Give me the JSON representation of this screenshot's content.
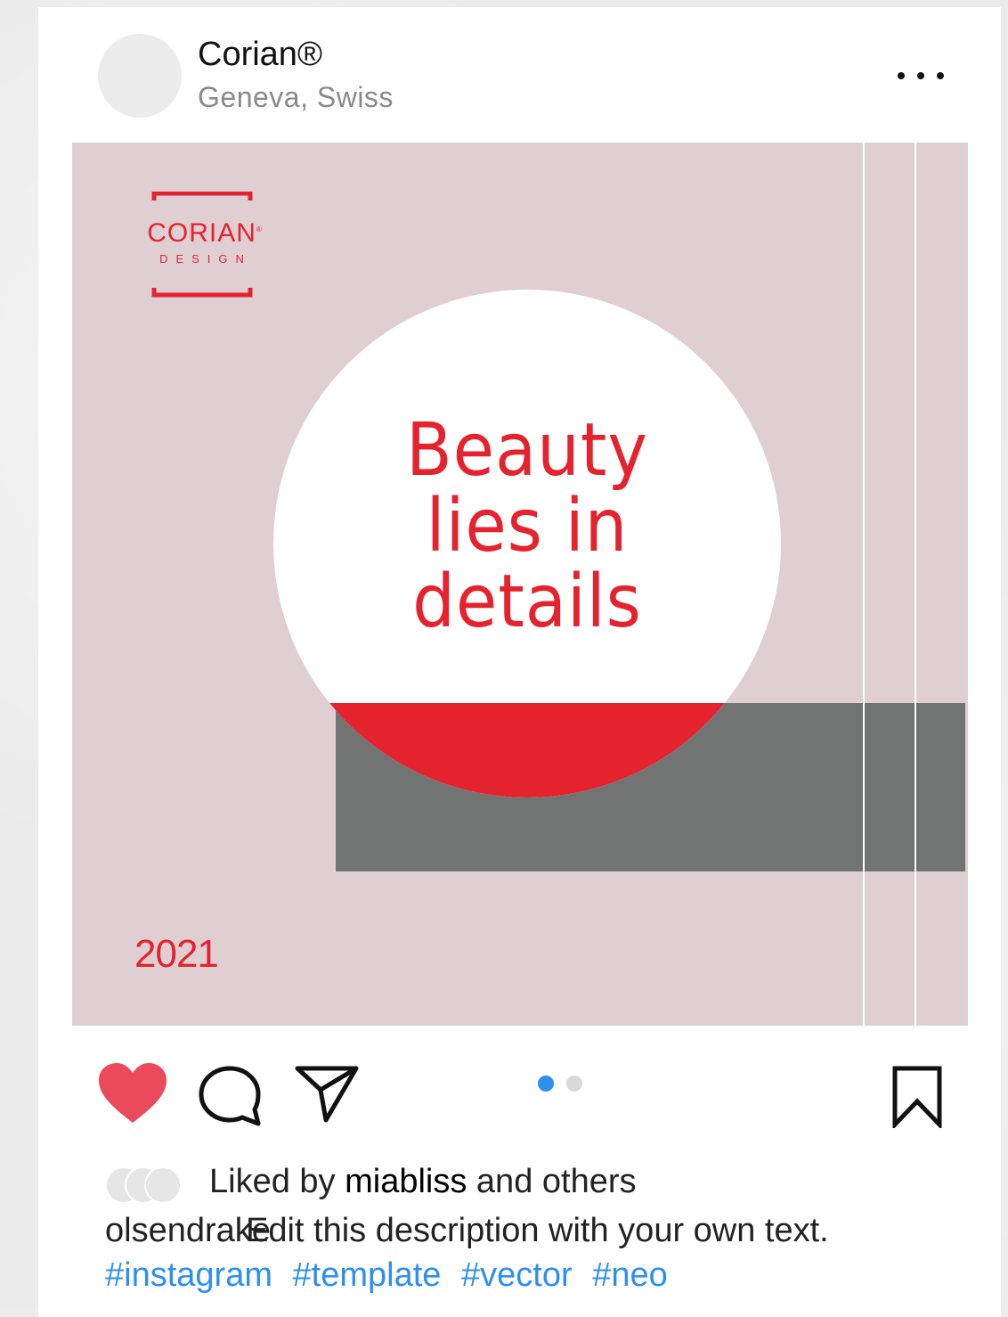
{
  "post": {
    "user_name": "Corian®",
    "location": "Geneva, Swiss",
    "more_icon": "more-horizontal-icon"
  },
  "image": {
    "logo_word": "CORIAN",
    "logo_reg": "®",
    "logo_sub": "DESIGN",
    "headline_lines": [
      "Beauty",
      "lies in",
      "details"
    ],
    "year": "2021",
    "colors": {
      "background": "#e0cfd2",
      "accent_red": "#e4232e",
      "gray_band": "#727473",
      "circle": "#ffffff"
    }
  },
  "actions": {
    "like_icon": "heart-icon",
    "comment_icon": "comment-icon",
    "share_icon": "send-icon",
    "save_icon": "bookmark-icon",
    "like_color": "#ea4a5a",
    "carousel": {
      "total": 2,
      "active": 1,
      "active_color": "#2f8ff0",
      "inactive_color": "#d9d9d9"
    }
  },
  "likes": {
    "prefix": "Liked by",
    "user": "miabliss",
    "suffix": "and others"
  },
  "caption": {
    "user": "olsendrake",
    "text": "Edit this description with your own text."
  },
  "hashtags": [
    "#instagram",
    "#template",
    "#vector",
    "#neo"
  ]
}
